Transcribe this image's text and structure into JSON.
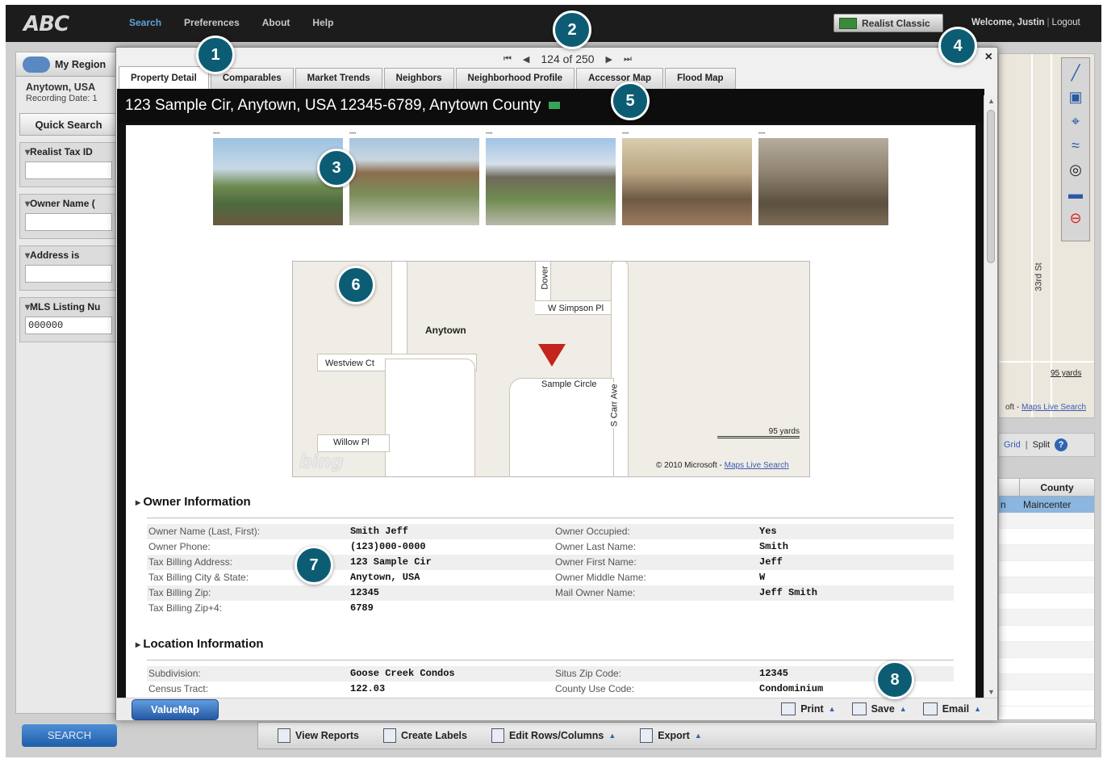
{
  "app": {
    "logo": "ABC"
  },
  "nav": {
    "items": [
      "Search",
      "Preferences",
      "About",
      "Help"
    ],
    "classic_button": "Realist Classic",
    "welcome": "Welcome, Justin",
    "logout": "Logout"
  },
  "sidebar": {
    "region_label": "My Region",
    "region_value": "Anytown, USA",
    "recording_date": "Recording Date: 1",
    "quick_search_tab": "Quick Search",
    "criteria": [
      {
        "label": "Realist Tax ID",
        "value": ""
      },
      {
        "label": "Owner Name (",
        "value": ""
      },
      {
        "label": "Address  is",
        "value": ""
      },
      {
        "label": "MLS Listing Nu",
        "value": "000000"
      }
    ],
    "search_button": "SEARCH"
  },
  "right_pane": {
    "street_label": "33rd St",
    "scale_label": "95 yards",
    "copyright_prefix": "oft - ",
    "copyright_link": "Maps Live Search",
    "grid_link": "Grid",
    "split_link": "Split",
    "help_icon": "?",
    "col_county": "County",
    "selected_row_prefix": "n",
    "selected_row_county": "Maincenter"
  },
  "bottom_toolbar": {
    "view_reports": "View Reports",
    "create_labels": "Create Labels",
    "edit_rows": "Edit Rows/Columns",
    "export": "Export"
  },
  "modal": {
    "pager": {
      "current": "124 of 250"
    },
    "close": "×",
    "tabs": [
      "Property Detail",
      "Comparables",
      "Market Trends",
      "Neighbors",
      "Neighborhood Profile",
      "Accessor Map",
      "Flood Map"
    ],
    "address": "123 Sample Cir, Anytown, USA  12345-6789, Anytown County",
    "map": {
      "town": "Anytown",
      "streets": [
        "Dover",
        "W Simpson Pl",
        "Westview Ct",
        "Sample Circle",
        "S Carr Ave",
        "Willow Pl"
      ],
      "logo": "bing",
      "scale": "95 yards",
      "copyright_prefix": "© 2010 Microsoft - ",
      "copyright_link": "Maps Live Search"
    },
    "owner_section": {
      "title": "Owner Information",
      "rows": [
        [
          "Owner Name (Last, First):",
          "Smith Jeff",
          "Owner Occupied:",
          "Yes"
        ],
        [
          "Owner Phone:",
          "(123)000-0000",
          "Owner Last Name:",
          "Smith"
        ],
        [
          "Tax Billing Address:",
          "123 Sample Cir",
          "Owner First Name:",
          "Jeff"
        ],
        [
          "Tax Billing City & State:",
          "Anytown, USA",
          "Owner Middle Name:",
          "W"
        ],
        [
          "Tax Billing Zip:",
          "12345",
          "Mail Owner Name:",
          "Jeff Smith"
        ],
        [
          "Tax Billing Zip+4:",
          "6789",
          "",
          ""
        ]
      ]
    },
    "location_section": {
      "title": "Location Information",
      "rows": [
        [
          "Subdivision:",
          "Goose Creek Condos",
          "Situs Zip Code:",
          "12345"
        ],
        [
          "Census Tract:",
          "122.03",
          "County Use Code:",
          "Condominium"
        ]
      ]
    },
    "footer": {
      "valuemap": "ValueMap",
      "print": "Print",
      "save": "Save",
      "email": "Email"
    }
  },
  "callouts": [
    "1",
    "2",
    "3",
    "4",
    "5",
    "6",
    "7",
    "8"
  ]
}
